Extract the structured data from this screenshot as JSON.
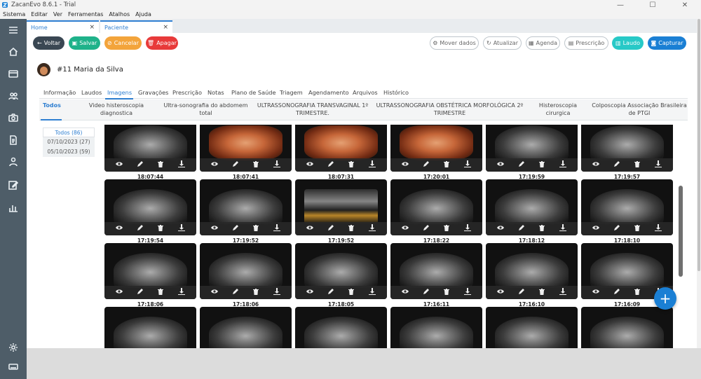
{
  "window": {
    "title": "ZacanEvo 8.6.1 - Trial"
  },
  "menu": [
    "Sistema",
    "Editar",
    "Ver",
    "Ferramentas",
    "Atalhos",
    "Ajuda"
  ],
  "doc_tabs": [
    {
      "label": "Home",
      "close": "×"
    },
    {
      "label": "Paciente",
      "close": "×"
    }
  ],
  "toolbar": {
    "voltar": "Voltar",
    "salvar": "Salvar",
    "cancelar": "Cancelar",
    "apagar": "Apagar",
    "mover_dados": "Mover dados",
    "atualizar": "Atualizar",
    "agenda": "Agenda",
    "prescricao": "Prescrição",
    "laudo": "Laudo",
    "capturar": "Capturar"
  },
  "colors": {
    "voltar": "#3a4753",
    "salvar": "#1fb28a",
    "cancelar": "#f3a43b",
    "apagar": "#e83a3a",
    "laudo": "#27c9c7",
    "capturar": "#1a7fd4",
    "accent": "#2f7fd1",
    "sidebar": "#4e5d68"
  },
  "patient": {
    "name": "#11 Maria da Silva"
  },
  "main_tabs": [
    "Informação",
    "Laudos",
    "Imagens",
    "Gravações",
    "Prescrição",
    "Notas",
    "Plano de Saúde",
    "Triagem",
    "Agendamento",
    "Arquivos",
    "Histórico"
  ],
  "main_tab_active": "Imagens",
  "exam_tabs": [
    "Todos",
    "Video histeroscopia diagnostica",
    "Ultra-sonografia do abdomem total",
    "ULTRASSONOGRAFIA TRANSVAGINAL 1º TRIMESTRE.",
    "ULTRASSONOGRAFIA OBSTÉTRICA MORFOLÓGICA 2º TRIMESTRE",
    "Histeroscopia cirurgica",
    "Colposcopia Associação Brasileira de PTGI"
  ],
  "date_filters": [
    "Todos (86)",
    "07/10/2023 (27)",
    "05/10/2023 (59)"
  ],
  "image_times": [
    [
      "18:07:44",
      "18:07:41",
      "18:07:31",
      "17:20:01",
      "17:19:59",
      "17:19:57"
    ],
    [
      "17:19:54",
      "17:19:52",
      "17:19:52",
      "17:18:22",
      "17:18:12",
      "17:18:10"
    ],
    [
      "17:18:06",
      "17:18:06",
      "17:18:05",
      "17:16:11",
      "17:16:10",
      "17:16:09"
    ]
  ],
  "image_actions": [
    "eye-icon",
    "pencil-icon",
    "trash-icon",
    "download-icon"
  ],
  "fab": {
    "label": "+"
  }
}
